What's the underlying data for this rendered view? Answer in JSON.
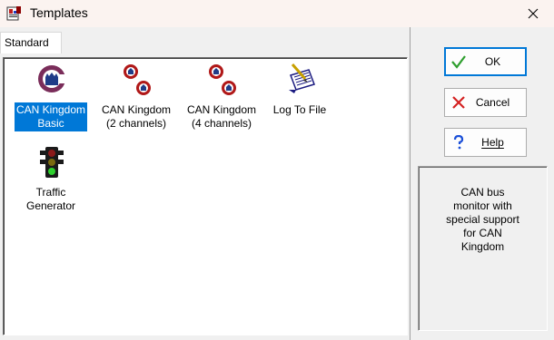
{
  "window": {
    "title": "Templates"
  },
  "tabs": [
    {
      "label": "Standard"
    }
  ],
  "templates": [
    {
      "name": "CAN Kingdom\nBasic",
      "icon": "can-kingdom-logo-icon",
      "selected": true
    },
    {
      "name": "CAN Kingdom\n(2 channels)",
      "icon": "can-kingdom-2-icon",
      "selected": false
    },
    {
      "name": "CAN Kingdom\n(4 channels)",
      "icon": "can-kingdom-4-icon",
      "selected": false
    },
    {
      "name": "Log To File",
      "icon": "log-notepad-icon",
      "selected": false
    },
    {
      "name": "Traffic\nGenerator",
      "icon": "traffic-light-icon",
      "selected": false
    }
  ],
  "buttons": {
    "ok": "OK",
    "cancel": "Cancel",
    "help": "Help"
  },
  "description": "CAN bus\nmonitor with\nspecial support\nfor CAN\nKingdom",
  "colors": {
    "selection": "#0078d7",
    "ok_check": "#2e9e2e",
    "cancel_x": "#d42020",
    "help_q": "#1a4fd8"
  }
}
